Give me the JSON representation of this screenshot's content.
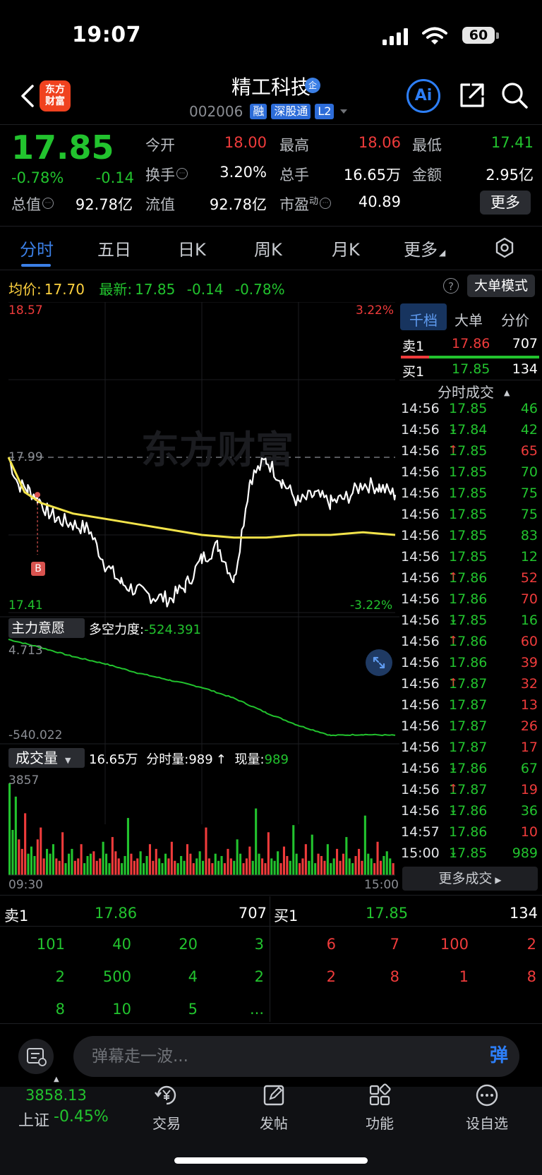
{
  "status_bar": {
    "time": "19:07",
    "battery": "60"
  },
  "header": {
    "logo_line1": "东方",
    "logo_line2": "财富",
    "stock_name": "精工科技",
    "verified_badge": "企",
    "stock_code": "002006",
    "tags": [
      "融",
      "深股通",
      "L2"
    ],
    "ai_label": "Ai"
  },
  "quote": {
    "last_price": "17.85",
    "change_pct": "-0.78%",
    "change_abs": "-0.14",
    "fields": [
      {
        "label": "今开",
        "value": "18.00",
        "color": "#ef3b3b"
      },
      {
        "label": "最高",
        "value": "18.06",
        "color": "#ef3b3b"
      },
      {
        "label": "最低",
        "value": "17.41",
        "color": "#22c32e"
      },
      {
        "label": "换手",
        "value": "3.20%",
        "color": "#ffffff"
      },
      {
        "label": "总手",
        "value": "16.65万",
        "color": "#ffffff"
      },
      {
        "label": "金额",
        "value": "2.95亿",
        "color": "#ffffff"
      },
      {
        "label": "总值",
        "value": "92.78亿",
        "color": "#ffffff"
      },
      {
        "label": "流值",
        "value": "92.78亿",
        "color": "#ffffff"
      },
      {
        "label": "市盈",
        "label_sup": "动",
        "value": "40.89",
        "color": "#ffffff"
      }
    ],
    "more_label": "更多"
  },
  "tabs": [
    "分时",
    "五日",
    "日K",
    "周K",
    "月K",
    "更多"
  ],
  "chart_header": {
    "avg_label": "均价:",
    "avg_value": "17.70",
    "latest_label": "最新:",
    "latest_value": "17.85",
    "latest_change": "-0.14",
    "latest_pct": "-0.78%",
    "help": "?",
    "big_order_mode": "大单模式"
  },
  "chart_labels": {
    "price_top": "18.57",
    "pct_top": "3.22%",
    "price_ref": "17.99",
    "price_bottom": "17.41",
    "pct_bottom": "-3.22%",
    "watermark": "东方财富",
    "signal_marker": "B",
    "main_force_label": "主力意愿",
    "force_text_label": "多空力度:",
    "force_text_value": "-524.391",
    "force_top": "4.713",
    "force_bottom": "-540.022",
    "volume_label": "成交量",
    "volume_summary": "16.65万",
    "minute_vol_label": "分时量:",
    "minute_vol_value": "989",
    "cur_vol_label": "现量:",
    "cur_vol_value": "989",
    "vol_max": "3857",
    "time_start": "09:30",
    "time_end": "15:00"
  },
  "chart_data": [
    {
      "type": "line",
      "series": [
        {
          "name": "",
          "x": [
            0,
            6,
            12,
            18,
            24,
            30,
            40,
            50,
            60,
            70,
            80,
            90,
            100,
            110,
            120,
            130,
            140,
            150,
            160,
            170,
            180,
            190,
            200,
            210,
            220,
            230,
            240
          ],
          "y": [
            17.99,
            17.89,
            17.87,
            17.84,
            17.79,
            17.76,
            17.74,
            17.72,
            17.59,
            17.52,
            17.49,
            17.47,
            17.46,
            17.51,
            17.61,
            17.66,
            17.53,
            17.91,
            17.98,
            17.9,
            17.82,
            17.85,
            17.82,
            17.84,
            17.89,
            17.88,
            17.85
          ]
        },
        {
          "name": "",
          "x": [
            0,
            10,
            20,
            30,
            40,
            60,
            80,
            100,
            120,
            140,
            160,
            180,
            200,
            220,
            240
          ],
          "y": [
            17.99,
            17.86,
            17.82,
            17.8,
            17.78,
            17.76,
            17.74,
            17.72,
            17.7,
            17.69,
            17.69,
            17.7,
            17.7,
            17.71,
            17.7
          ]
        }
      ],
      "ylim": [
        17.41,
        18.57
      ]
    },
    {
      "type": "line",
      "series": [
        {
          "name": "",
          "x": [
            0,
            20,
            40,
            60,
            80,
            100,
            120,
            140,
            160,
            180,
            200,
            220,
            240
          ],
          "y": [
            4.713,
            -40,
            -90,
            -130,
            -180,
            -220,
            -260,
            -320,
            -400,
            -470,
            -525,
            -520,
            -524.391
          ]
        }
      ],
      "ylim": [
        -540.022,
        4.713
      ]
    },
    {
      "type": "bar",
      "ylim": [
        0,
        3857
      ],
      "values": [
        3857,
        1900,
        3300,
        1500,
        1100,
        2600,
        900,
        1200,
        800,
        1500,
        2000,
        700,
        1100,
        900,
        1300,
        700,
        600,
        1800,
        500,
        900,
        1100,
        600,
        700,
        1300,
        500,
        800,
        900,
        1000,
        600,
        700,
        1400,
        900,
        500,
        1600,
        1000,
        700,
        500,
        800,
        2400,
        900,
        600,
        700,
        1000,
        500,
        800,
        1300,
        600,
        1100,
        700,
        500,
        900,
        700,
        1400,
        600,
        500,
        800,
        600,
        1300,
        900,
        500,
        700,
        1000,
        600,
        2000,
        700,
        500,
        900,
        600,
        800,
        500,
        1100,
        700,
        600,
        1500,
        900,
        500,
        700,
        1200,
        600,
        2800,
        900,
        700,
        500,
        1800,
        700,
        600,
        1000,
        500,
        1200,
        800,
        600,
        2100,
        900,
        500,
        700,
        1300,
        600,
        1700,
        500,
        900,
        800,
        600,
        1300,
        500,
        700,
        1100,
        600,
        900,
        1600,
        700,
        500,
        800,
        1100,
        600,
        2500,
        900,
        700,
        500,
        1400,
        600,
        800,
        1000,
        700,
        500
      ]
    }
  ],
  "right_panel": {
    "tabs": [
      "千档",
      "大单",
      "分价"
    ],
    "sell1": {
      "label": "卖1",
      "price": "17.86",
      "vol": "707"
    },
    "buy1": {
      "label": "买1",
      "price": "17.85",
      "vol": "134"
    },
    "ticks_title": "分时成交",
    "ticks": [
      {
        "time": "14:56",
        "price": "17.85",
        "arrow": "",
        "vol": "46",
        "dir": "s"
      },
      {
        "time": "14:56",
        "price": "17.84",
        "arrow": "↓",
        "vol": "42",
        "dir": "s"
      },
      {
        "time": "14:56",
        "price": "17.85",
        "arrow": "↑",
        "vol": "65",
        "dir": "b"
      },
      {
        "time": "14:56",
        "price": "17.85",
        "arrow": "",
        "vol": "70",
        "dir": "s"
      },
      {
        "time": "14:56",
        "price": "17.85",
        "arrow": "",
        "vol": "75",
        "dir": "s"
      },
      {
        "time": "14:56",
        "price": "17.85",
        "arrow": "",
        "vol": "75",
        "dir": "s"
      },
      {
        "time": "14:56",
        "price": "17.85",
        "arrow": "",
        "vol": "83",
        "dir": "s"
      },
      {
        "time": "14:56",
        "price": "17.85",
        "arrow": "",
        "vol": "12",
        "dir": "s"
      },
      {
        "time": "14:56",
        "price": "17.86",
        "arrow": "↑",
        "vol": "52",
        "dir": "b"
      },
      {
        "time": "14:56",
        "price": "17.86",
        "arrow": "",
        "vol": "70",
        "dir": "b"
      },
      {
        "time": "14:56",
        "price": "17.85",
        "arrow": "↓",
        "vol": "16",
        "dir": "s"
      },
      {
        "time": "14:56",
        "price": "17.86",
        "arrow": "↑",
        "vol": "60",
        "dir": "b"
      },
      {
        "time": "14:56",
        "price": "17.86",
        "arrow": "",
        "vol": "39",
        "dir": "b"
      },
      {
        "time": "14:56",
        "price": "17.87",
        "arrow": "↑",
        "vol": "32",
        "dir": "b"
      },
      {
        "time": "14:56",
        "price": "17.87",
        "arrow": "",
        "vol": "13",
        "dir": "b"
      },
      {
        "time": "14:56",
        "price": "17.87",
        "arrow": "",
        "vol": "26",
        "dir": "b"
      },
      {
        "time": "14:56",
        "price": "17.87",
        "arrow": "",
        "vol": "17",
        "dir": "b"
      },
      {
        "time": "14:56",
        "price": "17.86",
        "arrow": "↓",
        "vol": "67",
        "dir": "s"
      },
      {
        "time": "14:56",
        "price": "17.87",
        "arrow": "↑",
        "vol": "19",
        "dir": "b"
      },
      {
        "time": "14:56",
        "price": "17.86",
        "arrow": "↓",
        "vol": "36",
        "dir": "s"
      },
      {
        "time": "14:57",
        "price": "17.86",
        "arrow": "",
        "vol": "10",
        "dir": "b"
      },
      {
        "time": "15:00",
        "price": "17.85",
        "arrow": "↓",
        "vol": "989",
        "dir": "s"
      }
    ],
    "more_trades": "更多成交"
  },
  "orderbook": {
    "sell_label": "卖1",
    "sell_price": "17.86",
    "sell_vol": "707",
    "buy_label": "买1",
    "buy_price": "17.85",
    "buy_vol": "134",
    "sell_queue": [
      "101",
      "40",
      "20",
      "3",
      "2",
      "500",
      "4",
      "2",
      "8",
      "10",
      "5",
      "..."
    ],
    "buy_queue": [
      "6",
      "7",
      "100",
      "2",
      "2",
      "8",
      "1",
      "8"
    ]
  },
  "comment_bar": {
    "placeholder": "弹幕走一波...",
    "send_label": "弹"
  },
  "bottom_nav": {
    "index_value": "3858.13",
    "index_name": "上证",
    "index_pct": "-0.45%",
    "items": [
      "交易",
      "发帖",
      "功能",
      "设自选"
    ]
  }
}
